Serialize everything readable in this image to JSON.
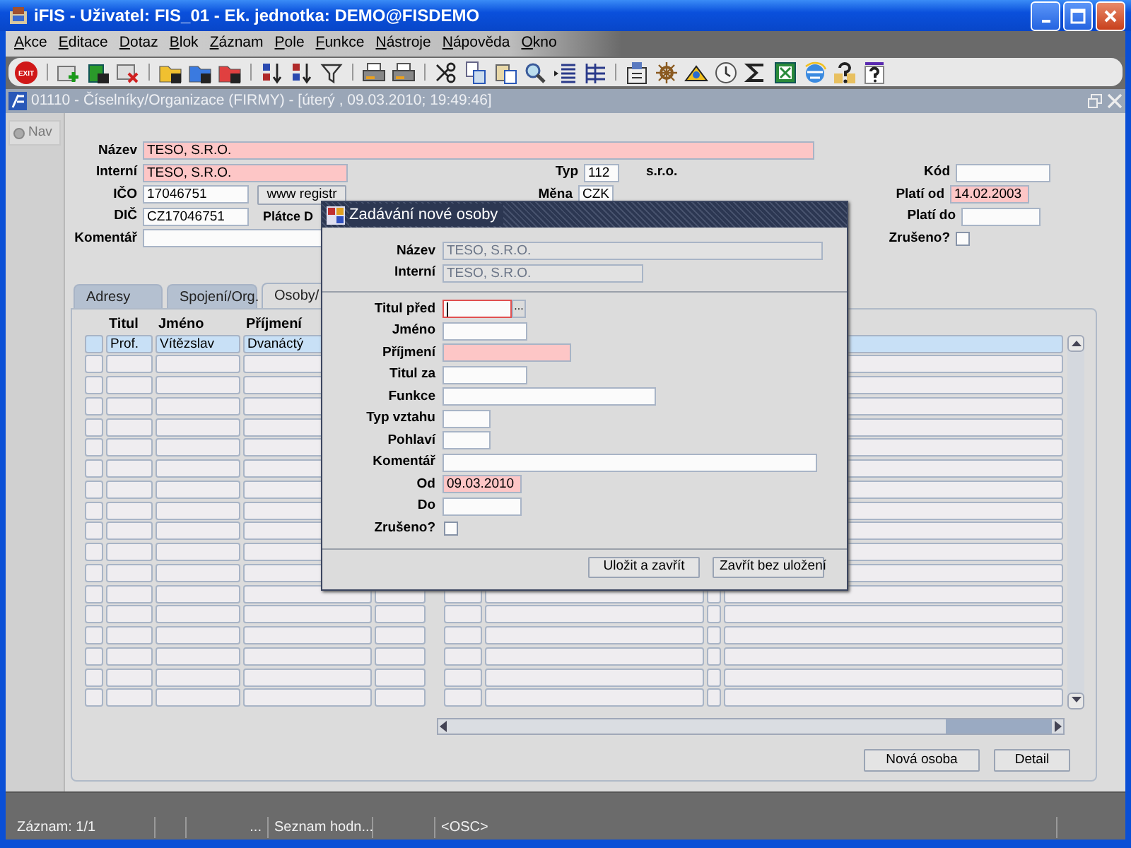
{
  "window": {
    "title": "iFIS - Uživatel: FIS_01 - Ek. jednotka: DEMO@FISDEMO"
  },
  "menu": [
    "Akce",
    "Editace",
    "Dotaz",
    "Blok",
    "Záznam",
    "Pole",
    "Funkce",
    "Nástroje",
    "Nápověda",
    "Okno"
  ],
  "toolbar": {
    "exit_label": "EXIT"
  },
  "form_window": {
    "title": "01110 - Číselníky/Organizace (FIRMY) - [úterý  , 09.03.2010; 19:49:46]"
  },
  "nav_button": "Nav",
  "form": {
    "name": {
      "label": "Název",
      "value": "TESO, S.R.O.",
      "required": true
    },
    "internal": {
      "label": "Interní",
      "value": "TESO, S.R.O.",
      "required": true
    },
    "ico": {
      "label": "IČO",
      "value": "17046751",
      "required": false
    },
    "registry_button": "www registr",
    "dic": {
      "label": "DIČ",
      "value": "CZ17046751",
      "required": false
    },
    "vat_payer_label": "Plátce D",
    "comment": {
      "label": "Komentář",
      "required": false
    },
    "type": {
      "label": "Typ",
      "value": "112",
      "required": false
    },
    "type_name": "s.r.o.",
    "currency": {
      "label": "Měna",
      "value": "CZK",
      "required": false
    },
    "code": {
      "label": "Kód",
      "required": false
    },
    "valid_from": {
      "label": "Platí od",
      "value": "14.02.2003",
      "required": true
    },
    "valid_to": {
      "label": "Platí do",
      "required": false
    },
    "cancelled": {
      "label": "Zrušeno?",
      "checked": false
    }
  },
  "tabs": [
    {
      "label": "Adresy",
      "selected": false
    },
    {
      "label": "Spojení/Org.",
      "selected": false
    },
    {
      "label": "Osoby/",
      "selected": true
    }
  ],
  "table": {
    "columns": [
      "Titul",
      "Jméno",
      "Příjmení"
    ],
    "rows": [
      {
        "selected": true,
        "cells": [
          "Prof.",
          "Vítězslav",
          "Dvanáctý"
        ]
      },
      {
        "selected": false
      },
      {
        "selected": false
      },
      {
        "selected": false
      },
      {
        "selected": false
      },
      {
        "selected": false
      },
      {
        "selected": false
      },
      {
        "selected": false
      },
      {
        "selected": false
      },
      {
        "selected": false
      },
      {
        "selected": false
      },
      {
        "selected": false
      },
      {
        "selected": false
      },
      {
        "selected": false
      },
      {
        "selected": false
      },
      {
        "selected": false
      },
      {
        "selected": false
      },
      {
        "selected": false
      }
    ]
  },
  "buttons": [
    "Nová osoba",
    "Detail"
  ],
  "status_bar": {
    "record": "Záznam: 1/1",
    "more": "...",
    "list": "Seznam hodn...",
    "mode": "<OSC>"
  },
  "dialog": {
    "title": "Zadávání nové osoby",
    "header_fields": [
      {
        "label": "Název",
        "value": "TESO, S.R.O.",
        "disabled": true
      },
      {
        "label": "Interní",
        "value": "TESO, S.R.O.",
        "disabled": true
      }
    ],
    "fields": [
      {
        "kind": "lookup",
        "label": "Titul před",
        "required": false,
        "focused": true,
        "button_label": "..."
      },
      {
        "kind": "field",
        "label": "Jméno",
        "required": false,
        "focused": false
      },
      {
        "kind": "field",
        "label": "Příjmení",
        "required": true,
        "focused": false
      },
      {
        "kind": "field",
        "label": "Titul za",
        "required": false,
        "focused": false
      },
      {
        "kind": "field",
        "label": "Funkce",
        "required": false,
        "focused": false
      },
      {
        "kind": "field",
        "label": "Typ vztahu",
        "required": false,
        "focused": false
      },
      {
        "kind": "field",
        "label": "Pohlaví",
        "required": false,
        "focused": false
      },
      {
        "kind": "field",
        "label": "Komentář",
        "required": false,
        "focused": false
      },
      {
        "kind": "field",
        "label": "Od",
        "value": "09.03.2010",
        "required": true,
        "focused": false
      },
      {
        "kind": "field",
        "label": "Do",
        "required": false,
        "focused": false
      },
      {
        "kind": "checkbox",
        "label": "Zrušeno?",
        "checked": false
      }
    ],
    "buttons": [
      "Uložit a zavřít",
      "Zavřít bez uložení"
    ]
  }
}
